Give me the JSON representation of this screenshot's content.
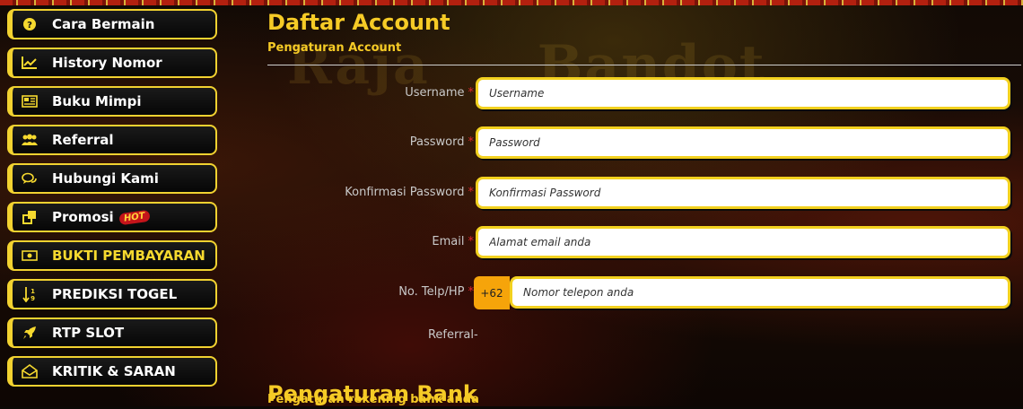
{
  "sidebar": {
    "items": [
      {
        "label": "Cara Bermain",
        "icon": "question-circle-icon"
      },
      {
        "label": "History Nomor",
        "icon": "line-chart-icon"
      },
      {
        "label": "Buku Mimpi",
        "icon": "newspaper-icon"
      },
      {
        "label": "Referral",
        "icon": "users-icon"
      },
      {
        "label": "Hubungi Kami",
        "icon": "chat-bubbles-icon"
      },
      {
        "label": "Promosi",
        "icon": "clone-icon",
        "badge": "HOT"
      },
      {
        "label": "BUKTI PEMBAYARAN",
        "icon": "money-bill-icon"
      },
      {
        "label": "PREDIKSI TOGEL",
        "icon": "sort-numeric-icon"
      },
      {
        "label": "RTP SLOT",
        "icon": "rocket-icon"
      },
      {
        "label": "KRITIK & SARAN",
        "icon": "envelope-open-icon"
      }
    ]
  },
  "watermark": {
    "left": "Raja",
    "right": "Bandot"
  },
  "form": {
    "title": "Daftar Account",
    "subtitle": "Pengaturan Account",
    "username": {
      "label": "Username",
      "required": "*",
      "placeholder": "Username"
    },
    "password": {
      "label": "Password",
      "required": "*",
      "placeholder": "Password"
    },
    "confirm": {
      "label": "Konfirmasi Password",
      "required": "*",
      "placeholder": "Konfirmasi Password"
    },
    "email": {
      "label": "Email",
      "required": "*",
      "placeholder": "Alamat email anda"
    },
    "phone": {
      "label": "No. Telp/HP",
      "required": "*",
      "prefix": "+62",
      "placeholder": "Nomor telepon anda"
    },
    "referral": {
      "label": "Referral",
      "value": "-"
    }
  },
  "bank": {
    "title": "Pengaturan Bank",
    "subtitle": "Pengaturan rekening bank anda"
  },
  "colors": {
    "accent": "#f6cb26",
    "border": "#f3d11f",
    "required": "#e2282b",
    "prefix_bg": "#f6a40a"
  }
}
